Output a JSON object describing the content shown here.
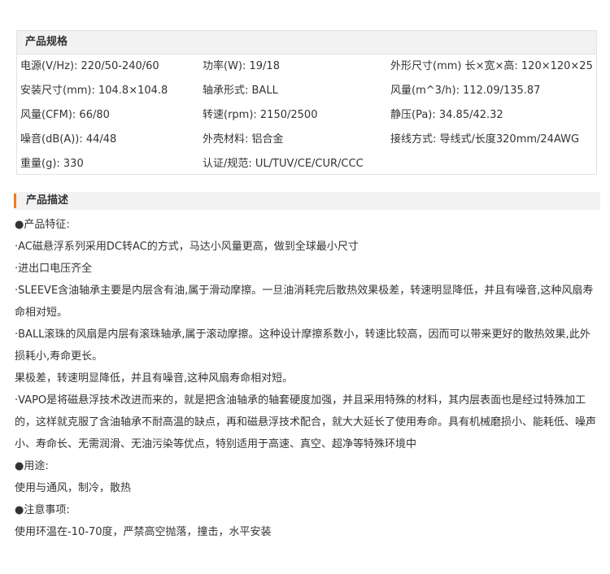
{
  "spec": {
    "title": "产品规格",
    "rows": [
      [
        "电源(V/Hz): 220/50-240/60",
        "功率(W): 19/18",
        "外形尺寸(mm) 长×宽×高: 120×120×25"
      ],
      [
        "安装尺寸(mm): 104.8×104.8",
        "轴承形式: BALL",
        "风量(m^3/h): 112.09/135.87"
      ],
      [
        "风量(CFM): 66/80",
        "转速(rpm): 2150/2500",
        "静压(Pa): 34.85/42.32"
      ],
      [
        "噪音(dB(A)): 44/48",
        "外壳材料: 铝合金",
        "接线方式: 导线式/长度320mm/24AWG"
      ],
      [
        "重量(g): 330",
        "认证/规范: UL/TUV/CE/CUR/CCC",
        ""
      ]
    ]
  },
  "desc": {
    "title": "产品描述",
    "lines": [
      "●产品特征:",
      "·AC磁悬浮系列采用DC转AC的方式，马达小风量更高，做到全球最小尺寸",
      "·进出口电压齐全",
      "·SLEEVE含油轴承主要是内层含有油,属于滑动摩擦。一旦油消耗完后散热效果极差，转速明显降低，并且有噪音,这种风扇寿",
      "命相对短。",
      "·BALL滚珠的风扇是内层有滚珠轴承,属于滚动摩擦。这种设计摩擦系数小，转速比较高，因而可以带来更好的散热效果,此外",
      "损耗小,寿命更长。",
      "果极差，转速明显降低，并且有噪音,这种风扇寿命相对短。",
      "·VAPO是将磁悬浮技术改进而来的，就是把含油轴承的轴套硬度加强，并且采用特殊的材料，其内层表面也是经过特殊加工",
      "的，这样就克服了含油轴承不耐高温的缺点，再和磁悬浮技术配合，就大大延长了使用寿命。具有机械磨损小、能耗低、噪声",
      "小、寿命长、无需润滑、无油污染等优点，特别适用于高速、真空、超净等特殊环境中",
      "●用途:",
      "使用与通风，制冷，散热",
      "●注意事项:",
      "使用环温在-10-70度，严禁高空抛落，撞击，水平安装"
    ]
  }
}
